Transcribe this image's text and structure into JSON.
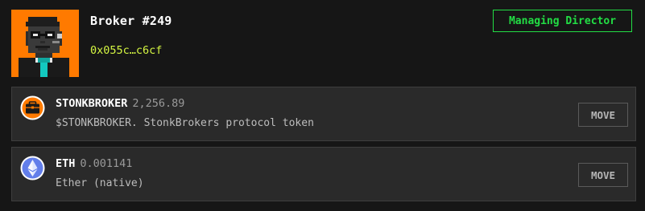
{
  "header": {
    "broker_name": "Broker #249",
    "broker_address": "0x055c…c6cf",
    "role_badge": "Managing Director",
    "avatar_icon": "pixel-broker-avatar",
    "colors": {
      "avatar_bg": "#ff7a00",
      "address": "#d4f542",
      "badge": "#22dd44"
    }
  },
  "tokens": [
    {
      "symbol": "STONKBROKER",
      "balance": "2,256.89",
      "description": "$STONKBROKER. StonkBrokers protocol token",
      "icon": "briefcase-icon",
      "action_label": "MOVE"
    },
    {
      "symbol": "ETH",
      "balance": "0.001141",
      "description": "Ether (native)",
      "icon": "ethereum-icon",
      "action_label": "MOVE"
    }
  ]
}
